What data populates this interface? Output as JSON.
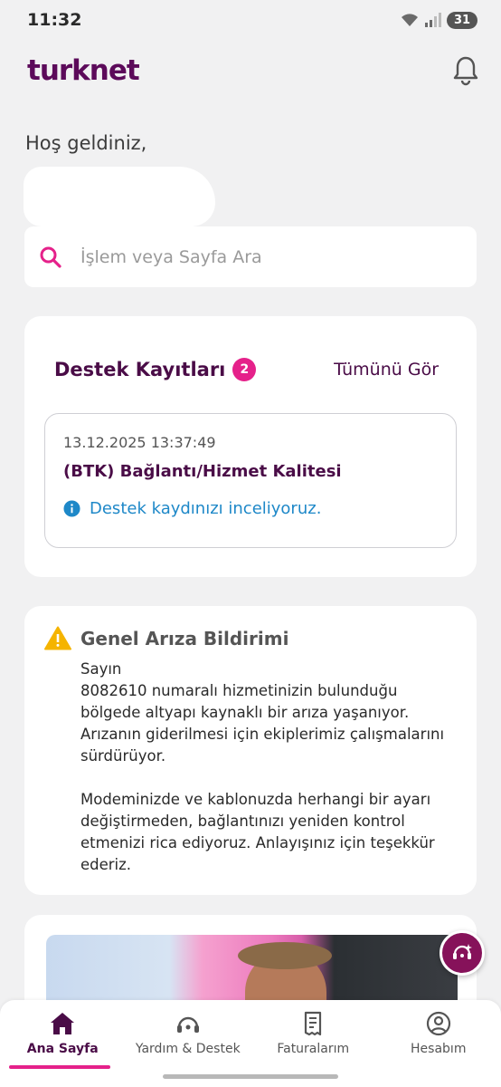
{
  "status_bar": {
    "time": "11:32",
    "battery": "31"
  },
  "header": {
    "logo": "turknet"
  },
  "welcome": {
    "greeting": "Hoş geldiniz,"
  },
  "search": {
    "placeholder": "İşlem veya Sayfa Ara"
  },
  "support": {
    "title": "Destek Kayıtları",
    "count": "2",
    "see_all": "Tümünü Gör",
    "ticket": {
      "date": "13.12.2025 13:37:49",
      "title": "(BTK) Bağlantı/Hizmet Kalitesi",
      "status": "Destek kaydınızı inceliyoruz."
    }
  },
  "outage": {
    "title": "Genel Arıza Bildirimi",
    "greeting": "Sayın",
    "paragraph1": "8082610 numaralı hizmetinizin bulunduğu bölgede altyapı kaynaklı bir arıza yaşanıyor. Arızanın giderilmesi için ekiplerimiz çalışmalarını sürdürüyor.",
    "paragraph2": "Modeminizde ve kablonuzda herhangi bir ayarı değiştirmeden, bağlantınızı yeniden kontrol etmenizi rica ediyoruz. Anlayışınız için teşekkür ederiz."
  },
  "bottom_nav": {
    "items": [
      {
        "label": "Ana Sayfa",
        "icon": "home-icon",
        "active": true
      },
      {
        "label": "Yardım & Destek",
        "icon": "support-headset-icon",
        "active": false
      },
      {
        "label": "Faturalarım",
        "icon": "invoice-icon",
        "active": false
      },
      {
        "label": "Hesabım",
        "icon": "account-icon",
        "active": false
      }
    ]
  },
  "colors": {
    "brand": "#4a0c47",
    "accent": "#e5218a",
    "info": "#1e88c8",
    "warning": "#f5b400"
  }
}
